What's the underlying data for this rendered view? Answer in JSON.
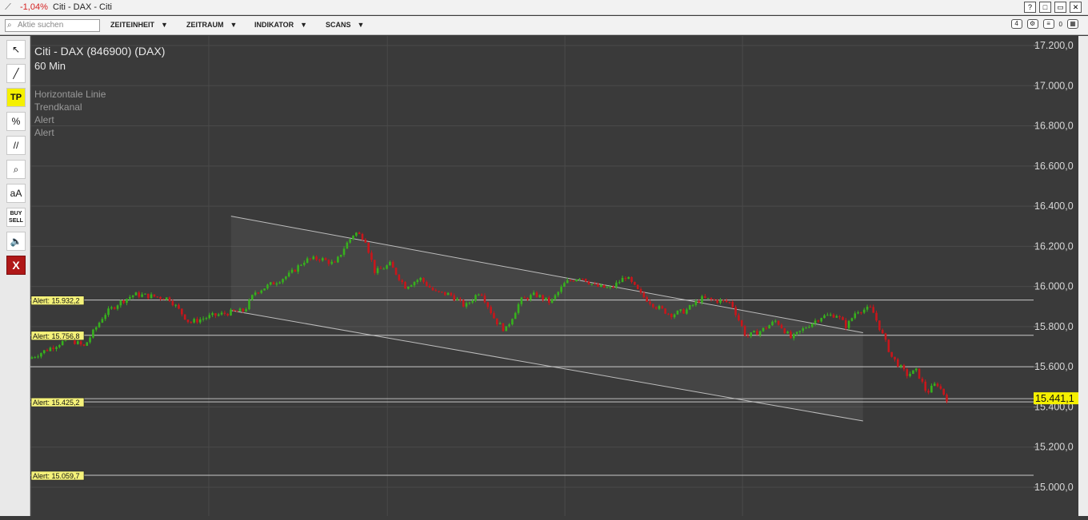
{
  "window": {
    "change": "-1,04%",
    "title": "Citi - DAX - Citi",
    "buttons": [
      "?",
      "□",
      "▭",
      "✕"
    ]
  },
  "toolbar": {
    "search_placeholder": "Aktie suchen",
    "menus": [
      "ZEITEINHEIT",
      "ZEITRAUM",
      "INDIKATOR",
      "SCANS"
    ],
    "badge_count": "4",
    "count_right": "0"
  },
  "chart": {
    "instrument": "Citi - DAX (846900) (DAX)",
    "interval": "60 Min",
    "overlays": [
      "Horizontale Linie",
      "Trendkanal",
      "Alert",
      "Alert"
    ],
    "last_price_label": "15.441,1"
  },
  "sidebar_tools": [
    {
      "name": "pointer-tool",
      "label": "↖"
    },
    {
      "name": "line-tool",
      "label": "╱"
    },
    {
      "name": "tp-tool",
      "label": "TP"
    },
    {
      "name": "percent-tool",
      "label": "%"
    },
    {
      "name": "parallel-lines-tool",
      "label": "//"
    },
    {
      "name": "zoom-tool",
      "label": "⌕"
    },
    {
      "name": "text-tool",
      "label": "aA"
    },
    {
      "name": "buy-sell-tool",
      "label": "BUY SELL"
    },
    {
      "name": "sound-tool",
      "label": "🔈"
    },
    {
      "name": "delete-tool",
      "label": "X"
    }
  ],
  "colors": {
    "background": "#3a3a3a",
    "up_candle": "#37b11d",
    "down_candle": "#c8161b",
    "alert_label_bg": "#f5f27a",
    "price_label_bg": "#f5f000",
    "line": "#bdbdbd"
  },
  "chart_data": {
    "type": "candlestick",
    "ylim": [
      14950,
      17250
    ],
    "y_ticks": [
      {
        "value": 15000,
        "label": "15.000,0"
      },
      {
        "value": 15200,
        "label": "15.200,0"
      },
      {
        "value": 15400,
        "label": "15.400,0"
      },
      {
        "value": 15600,
        "label": "15.600,0"
      },
      {
        "value": 15800,
        "label": "15.800,0"
      },
      {
        "value": 16000,
        "label": "16.000,0"
      },
      {
        "value": 16200,
        "label": "16.200,0"
      },
      {
        "value": 16400,
        "label": "16.400,0"
      },
      {
        "value": 16600,
        "label": "16.600,0"
      },
      {
        "value": 16800,
        "label": "16.800,0"
      },
      {
        "value": 17000,
        "label": "17.000,0"
      },
      {
        "value": 17200,
        "label": "17.200,0"
      }
    ],
    "alerts": [
      {
        "value": 15932.2,
        "label": "Alert: 15.932,2"
      },
      {
        "value": 15756.8,
        "label": "Alert: 15.756,8"
      },
      {
        "value": 15425.2,
        "label": "Alert: 15.425,2"
      },
      {
        "value": 15059.7,
        "label": "Alert: 15.059,7"
      }
    ],
    "horizontal_line": 15600,
    "last_price": 15441.1,
    "channel": {
      "upper": [
        [
          0.2,
          16350
        ],
        [
          0.83,
          15770
        ]
      ],
      "lower": [
        [
          0.2,
          15880
        ],
        [
          0.83,
          15330
        ]
      ]
    },
    "close_path": [
      [
        0.0,
        15640
      ],
      [
        0.02,
        15690
      ],
      [
        0.04,
        15740
      ],
      [
        0.055,
        15700
      ],
      [
        0.075,
        15860
      ],
      [
        0.09,
        15920
      ],
      [
        0.105,
        15960
      ],
      [
        0.125,
        15950
      ],
      [
        0.14,
        15940
      ],
      [
        0.16,
        15820
      ],
      [
        0.18,
        15850
      ],
      [
        0.2,
        15870
      ],
      [
        0.215,
        15880
      ],
      [
        0.225,
        15970
      ],
      [
        0.245,
        16020
      ],
      [
        0.26,
        16060
      ],
      [
        0.275,
        16130
      ],
      [
        0.29,
        16140
      ],
      [
        0.305,
        16110
      ],
      [
        0.315,
        16200
      ],
      [
        0.325,
        16270
      ],
      [
        0.335,
        16240
      ],
      [
        0.345,
        16070
      ],
      [
        0.36,
        16110
      ],
      [
        0.375,
        16000
      ],
      [
        0.39,
        16040
      ],
      [
        0.405,
        15970
      ],
      [
        0.42,
        15960
      ],
      [
        0.435,
        15900
      ],
      [
        0.45,
        15980
      ],
      [
        0.465,
        15830
      ],
      [
        0.475,
        15780
      ],
      [
        0.49,
        15930
      ],
      [
        0.505,
        15960
      ],
      [
        0.52,
        15920
      ],
      [
        0.535,
        16020
      ],
      [
        0.55,
        16050
      ],
      [
        0.565,
        16000
      ],
      [
        0.58,
        15990
      ],
      [
        0.595,
        16050
      ],
      [
        0.61,
        15960
      ],
      [
        0.625,
        15900
      ],
      [
        0.64,
        15860
      ],
      [
        0.655,
        15880
      ],
      [
        0.67,
        15940
      ],
      [
        0.685,
        15930
      ],
      [
        0.7,
        15920
      ],
      [
        0.715,
        15750
      ],
      [
        0.73,
        15780
      ],
      [
        0.745,
        15830
      ],
      [
        0.76,
        15740
      ],
      [
        0.775,
        15800
      ],
      [
        0.79,
        15850
      ],
      [
        0.805,
        15860
      ],
      [
        0.815,
        15800
      ],
      [
        0.825,
        15880
      ],
      [
        0.84,
        15890
      ],
      [
        0.85,
        15770
      ],
      [
        0.86,
        15650
      ],
      [
        0.875,
        15560
      ],
      [
        0.885,
        15580
      ],
      [
        0.895,
        15470
      ],
      [
        0.905,
        15520
      ],
      [
        0.915,
        15441
      ]
    ]
  }
}
